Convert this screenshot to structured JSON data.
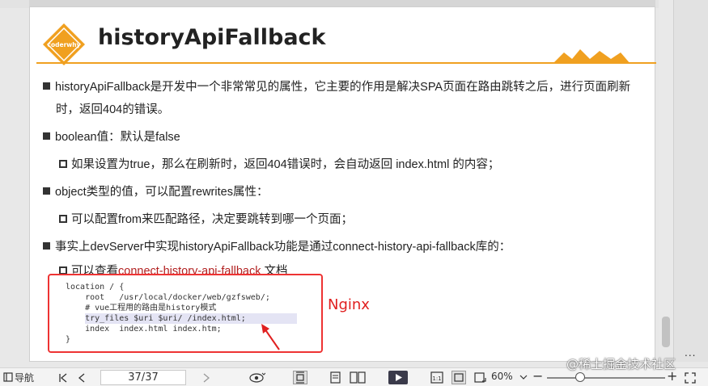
{
  "slide": {
    "logo_text": "coderwhy",
    "title": "historyApiFallback",
    "bullets": [
      {
        "line1": "historyApiFallback是开发中一个非常常见的属性，它主要的作用是解决SPA页面在路由跳转之后，进行页面刷新",
        "line2": "时，返回404的错误。"
      },
      {
        "line1": "boolean值：默认是false"
      },
      {
        "sub": "如果设置为true，那么在刷新时，返回404错误时，会自动返回 index.html 的内容；"
      },
      {
        "line1": "object类型的值，可以配置rewrites属性："
      },
      {
        "sub": "可以配置from来匹配路径，决定要跳转到哪一个页面；"
      },
      {
        "line1": "事实上devServer中实现historyApiFallback功能是通过connect-history-api-fallback库的："
      },
      {
        "sub_prefix": "可以查看",
        "sub_link": "connect-history-api-fallback",
        "sub_suffix": " 文档"
      }
    ],
    "code_lines": [
      "location / {",
      "    root   /usr/local/docker/web/gzfsweb/;",
      "    # vue工程用的路由是history模式",
      "    try_files $uri $uri/ /index.html;",
      "    index  index.html index.htm;",
      "}"
    ],
    "annotation": "Nginx"
  },
  "toolbar": {
    "nav_label": "导航",
    "page_value": "37/37",
    "zoom_value": "60%",
    "watermark": "@稀土掘金技术社区",
    "dots": "..."
  },
  "colors": {
    "accent": "#f0a020",
    "annotation_red": "#e02020",
    "link": "#b22222"
  }
}
